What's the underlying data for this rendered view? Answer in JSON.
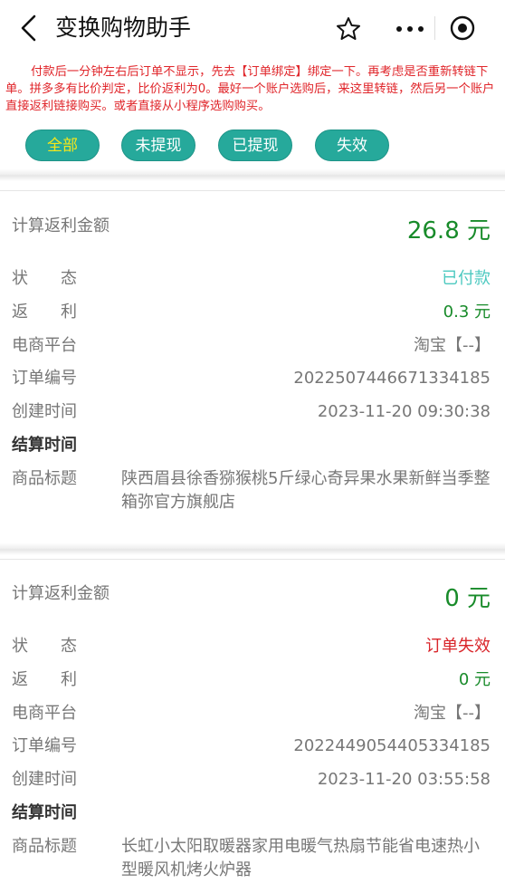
{
  "header": {
    "title": "变换购物助手",
    "icons": [
      "back-icon",
      "star-icon",
      "more-icon",
      "record-icon"
    ]
  },
  "notice": "付款后一分钟左右后订单不显示，先去【订单绑定】绑定一下。再考虑是否重新转链下单。拼多多有比价判定，比价返利为0。最好一个账户选购后，来这里转链，然后另一个账户直接返利链接购买。或者直接从小程序选购购买。",
  "filters": [
    {
      "label": "全部",
      "active": true
    },
    {
      "label": "未提现",
      "active": false
    },
    {
      "label": "已提现",
      "active": false
    },
    {
      "label": "失效",
      "active": false
    }
  ],
  "labels": {
    "rebate_amount": "计算返利金额",
    "status": "状　　态",
    "rebate": "返　　利",
    "platform": "电商平台",
    "order_no": "订单编号",
    "created": "创建时间",
    "settled": "结算时间",
    "product": "商品标题"
  },
  "orders": [
    {
      "amount": "26.8 元",
      "status": "已付款",
      "rebate": "0.3 元",
      "platform": "淘宝【--】",
      "order_no": "2022507446671334185",
      "created": "2023-11-20 09:30:38",
      "settled": "",
      "product": "陕西眉县徐香猕猴桃5斤绿心奇异果水果新鲜当季整箱弥官方旗舰店"
    },
    {
      "amount": "0 元",
      "status": "订单失效",
      "rebate": "0 元",
      "platform": "淘宝【--】",
      "order_no": "2022449054405334185",
      "created": "2023-11-20 03:55:58",
      "settled": "",
      "product": "长虹小太阳取暖器家用电暖气热扇节能省电速热小型暖风机烤火炉器"
    }
  ],
  "colors": {
    "accent": "#26a99b",
    "active_pill_text": "#f7e71a",
    "notice": "#e0262b",
    "amount": "#188b2a",
    "paid": "#4cc9c0",
    "invalid": "#d9252a"
  }
}
